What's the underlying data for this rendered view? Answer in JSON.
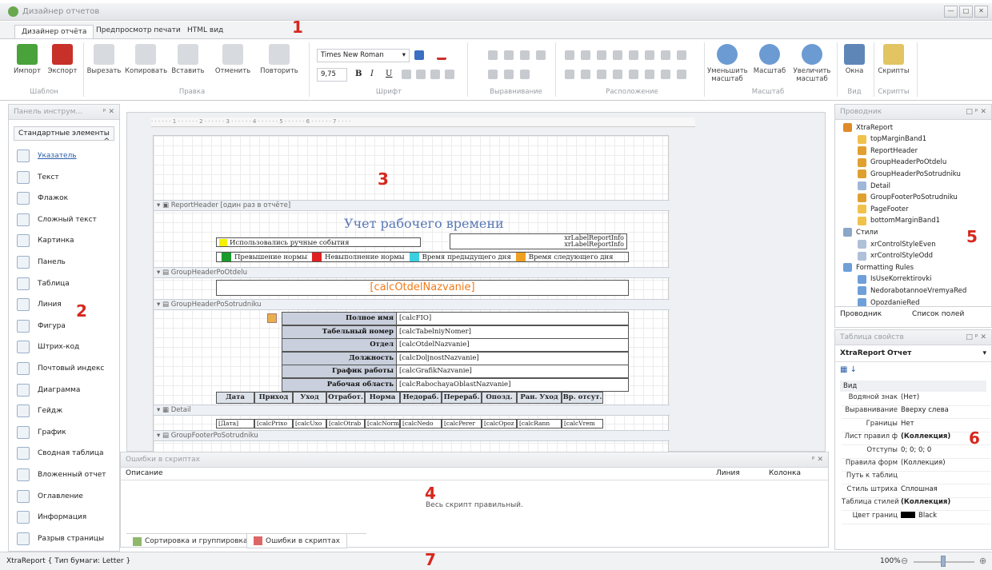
{
  "window": {
    "title": "Дизайнер отчетов",
    "minimize": "—",
    "maximize": "□",
    "close": "✕"
  },
  "ribbon_tabs": [
    "Дизайнер отчёта",
    "Предпросмотр печати",
    "HTML вид"
  ],
  "ribbon": {
    "import": "Импорт",
    "export": "Экспорт",
    "cut": "Вырезать",
    "copy": "Копировать",
    "paste": "Вставить",
    "undo": "Отменить",
    "redo": "Повторить",
    "font_name": "Times New Roman",
    "font_size": "9,75",
    "zoom_out": "Уменьшить масштаб",
    "zoom": "Масштаб",
    "zoom_in": "Увеличить масштаб",
    "windows": "Окна",
    "scripts": "Скрипты",
    "groups": {
      "template": "Шаблон",
      "edit": "Правка",
      "font": "Шрифт",
      "align": "Выравнивание",
      "layout": "Расположение",
      "scale": "Масштаб",
      "view": "Вид",
      "scripts": "Скрипты"
    }
  },
  "toolbox": {
    "title": "Панель инструм...",
    "category": "Стандартные элементы",
    "items": [
      {
        "label": "Указатель",
        "icon": "pointer-icon"
      },
      {
        "label": "Текст",
        "icon": "text-icon"
      },
      {
        "label": "Флажок",
        "icon": "checkbox-icon"
      },
      {
        "label": "Сложный текст",
        "icon": "richtext-icon"
      },
      {
        "label": "Картинка",
        "icon": "picture-icon"
      },
      {
        "label": "Панель",
        "icon": "panel-icon"
      },
      {
        "label": "Таблица",
        "icon": "table-icon"
      },
      {
        "label": "Линия",
        "icon": "line-icon"
      },
      {
        "label": "Фигура",
        "icon": "shape-icon"
      },
      {
        "label": "Штрих-код",
        "icon": "barcode-icon"
      },
      {
        "label": "Почтовый индекс",
        "icon": "zipcode-icon"
      },
      {
        "label": "Диаграмма",
        "icon": "chart-icon"
      },
      {
        "label": "Гейдж",
        "icon": "gauge-icon"
      },
      {
        "label": "График",
        "icon": "sparkline-icon"
      },
      {
        "label": "Сводная таблица",
        "icon": "pivot-icon"
      },
      {
        "label": "Вложенный отчет",
        "icon": "subreport-icon"
      },
      {
        "label": "Оглавление",
        "icon": "toc-icon"
      },
      {
        "label": "Информация",
        "icon": "info-icon"
      },
      {
        "label": "Разрыв страницы",
        "icon": "pagebreak-icon"
      }
    ]
  },
  "designer": {
    "ruler": "· · · · · · 1 · · · · · · 2 · · · · · · 3 · · · · · · 4 · · · · · · 5 · · · · · · 6 · · · · · · 7 · · · ·",
    "bands": {
      "report_header": "ReportHeader [один раз в отчёте]",
      "group_otdel": "GroupHeaderPoOtdelu",
      "group_sotr": "GroupHeaderPoSotrudniku",
      "detail": "Detail",
      "group_footer": "GroupFooterPoSotrudniku"
    },
    "report_title": "Учет рабочего времени",
    "manual_events": "Использовались ручные события",
    "report_info_1": "xrLabelReportInfo",
    "report_info_2": "xrLabelReportInfo",
    "legend": [
      {
        "label": "Превышение нормы",
        "color": "#1a9a2a"
      },
      {
        "label": "Невыполнение нормы",
        "color": "#e02020"
      },
      {
        "label": "Время предыдущего дня",
        "color": "#3ad0e0"
      },
      {
        "label": "Время следующего дня",
        "color": "#f0a020"
      }
    ],
    "manual_color": "#f5f000",
    "otdel_field": "[calcOtdelNazvanie]",
    "employee_fields": [
      {
        "label": "Полное имя",
        "value": "[calcFIO]"
      },
      {
        "label": "Табельный номер",
        "value": "[calcTabelniyNomer]"
      },
      {
        "label": "Отдел",
        "value": "[calcOtdelNazvanie]"
      },
      {
        "label": "Должность",
        "value": "[calcDoljnostNazvanie]"
      },
      {
        "label": "График работы",
        "value": "[calcGrafikNazvanie]"
      },
      {
        "label": "Рабочая область",
        "value": "[calcRabochayaOblastNazvanie]"
      }
    ],
    "columns": [
      "Дата",
      "Приход",
      "Уход",
      "Отработ.",
      "Норма",
      "Недораб.",
      "Перераб.",
      "Опозд.",
      "Ран. Уход",
      "Вр. отсут."
    ],
    "detail_cells": [
      "[Дата]",
      "[calcPrixo",
      "[calcUxo",
      "[calcOtrab",
      "[calcNorm",
      "[calcNedo",
      "[calcPerer",
      "[calcOpoz",
      "[calcRann",
      "[calcVrem"
    ]
  },
  "errors_panel": {
    "title": "Ошибки в скриптах",
    "col_description": "Описание",
    "col_line": "Линия",
    "col_column": "Колонка",
    "message": "Весь скрипт правильный.",
    "tab_sort": "Сортировка и группировка",
    "tab_errors": "Ошибки в скриптах"
  },
  "explorer": {
    "title": "Проводник",
    "nodes": [
      "XtraReport",
      "topMarginBand1",
      "ReportHeader",
      "GroupHeaderPoOtdelu",
      "GroupHeaderPoSotrudniku",
      "Detail",
      "GroupFooterPoSotrudniku",
      "PageFooter",
      "bottomMarginBand1",
      "Стили",
      "xrControlStyleEven",
      "xrControlStyleOdd",
      "Formatting Rules",
      "IsUseKorrektirovki",
      "NedorabotannoeVremyaRed",
      "OpozdanieRed"
    ],
    "tab_explorer": "Проводник",
    "tab_fields": "Список полей"
  },
  "properties": {
    "title": "Таблица свойств",
    "object": "XtraReport",
    "object_type": "Отчет",
    "category": "Вид",
    "rows": [
      {
        "name": "Водяной знак",
        "value": "(Нет)"
      },
      {
        "name": "Выравнивание",
        "value": "Вверху слева"
      },
      {
        "name": "Границы",
        "value": "Нет"
      },
      {
        "name": "Лист правил ф",
        "value": "(Коллекция)"
      },
      {
        "name": "Отступы",
        "value": "0; 0; 0; 0"
      },
      {
        "name": "Правила форм",
        "value": "(Коллекция)"
      },
      {
        "name": "Путь к таблиц",
        "value": ""
      },
      {
        "name": "Стиль штриха",
        "value": "Сплошная"
      },
      {
        "name": "Таблица стилей",
        "value": "(Коллекция)"
      },
      {
        "name": "Цвет границ",
        "value": "Black"
      }
    ]
  },
  "status": {
    "paper": "XtraReport { Тип бумаги: Letter }",
    "zoom": "100%",
    "minus": "⊖",
    "plus": "⊕"
  },
  "markers": [
    "1",
    "2",
    "3",
    "4",
    "5",
    "6",
    "7"
  ]
}
